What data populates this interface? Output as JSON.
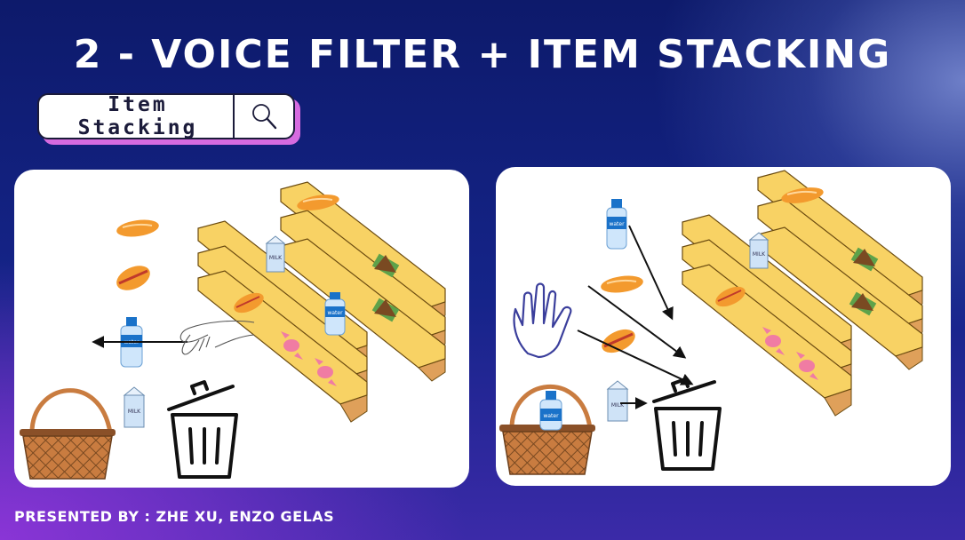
{
  "slide": {
    "title": "2 - VOICE FILTER + ITEM STACKING",
    "search_label": "Item Stacking",
    "footer": "PRESENTED BY : ZHE XU, ENZO GELAS"
  },
  "labels": {
    "water": "water",
    "milk": "MILK"
  },
  "colors": {
    "accent_shadow": "#d66be0",
    "shelf": "#f8d264",
    "shelf_side": "#dfa05a",
    "bread": "#f39a2e",
    "candy": "#f07ca3",
    "water_label": "#1a72c9",
    "basket": "#c97c40"
  },
  "icons": {
    "search": "magnifier-icon",
    "trash": "trash-can-icon",
    "hand": "open-hand-icon",
    "basket": "basket-icon"
  }
}
